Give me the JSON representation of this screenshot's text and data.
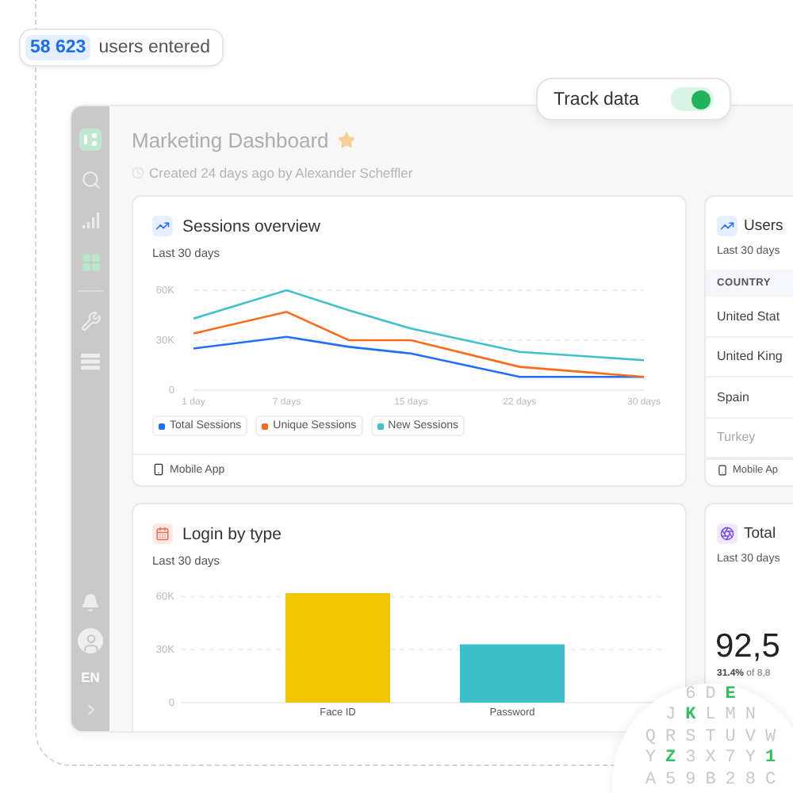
{
  "users_badge": {
    "count": "58 623",
    "label": "users entered"
  },
  "track_toggle": {
    "label": "Track data",
    "on": true
  },
  "sidebar": {
    "nav": [
      {
        "kind": "search",
        "selected": false
      },
      {
        "kind": "bars",
        "selected": false
      },
      {
        "kind": "grid",
        "selected": true
      },
      {
        "kind": "wrench",
        "selected": false
      },
      {
        "kind": "list",
        "selected": false
      }
    ],
    "language": "EN"
  },
  "header": {
    "title": "Marketing Dashboard",
    "starred": true,
    "subtitle": "Created 24 days ago by Alexander Scheffler"
  },
  "sessions_card": {
    "title": "Sessions overview",
    "period": "Last 30 days",
    "chart_data": {
      "type": "line",
      "x": [
        1,
        7,
        11,
        15,
        22,
        30
      ],
      "xlim": [
        1,
        30
      ],
      "xticks": [
        {
          "value": 1,
          "label": "1 day"
        },
        {
          "value": 7,
          "label": "7 days"
        },
        {
          "value": 15,
          "label": "15 days"
        },
        {
          "value": 22,
          "label": "22 days"
        },
        {
          "value": 30,
          "label": "30 days"
        }
      ],
      "yticks": [
        0,
        {
          "value": 30000,
          "label": "30K"
        },
        {
          "value": 60000,
          "label": "60K"
        }
      ],
      "ylim": [
        0,
        60000
      ],
      "series": [
        {
          "name": "Total Sessions",
          "color": "#1f6fff",
          "values": [
            25000,
            32000,
            26000,
            22000,
            8000,
            8000
          ]
        },
        {
          "name": "Unique Sessions",
          "color": "#ff6a1a",
          "values": [
            34000,
            47000,
            30000,
            30000,
            14000,
            8000
          ]
        },
        {
          "name": "New Sessions",
          "color": "#3fc1c9",
          "values": [
            43000,
            60000,
            48000,
            37000,
            23000,
            18000
          ]
        }
      ]
    },
    "footer": "Mobile App"
  },
  "users_card": {
    "title": "Users",
    "period": "Last 30 days",
    "column": "COUNTRY",
    "rows": [
      {
        "country": "United Stat",
        "faded": false
      },
      {
        "country": "United King",
        "faded": false
      },
      {
        "country": "Spain",
        "faded": false
      },
      {
        "country": "Turkey",
        "faded": true
      }
    ],
    "footer": "Mobile Ap"
  },
  "login_card": {
    "title": "Login by type",
    "period": "Last 30 days",
    "chart_data": {
      "type": "bar",
      "yticks": [
        0,
        {
          "value": 30000,
          "label": "30K"
        },
        {
          "value": 60000,
          "label": "60K"
        }
      ],
      "ylim": [
        0,
        62000
      ],
      "stacked": true,
      "series": [
        {
          "name": "Face ID",
          "color": "#f2c600",
          "values": [
            62000,
            null
          ]
        },
        {
          "name": "Password",
          "color": "#3bbfc9",
          "values": [
            null,
            33000
          ]
        }
      ]
    }
  },
  "total_card": {
    "title": "Total",
    "period": "Last 30 days",
    "value": "92,5",
    "note": "**31.4%** of 8,8"
  },
  "letter_grid": [
    [
      {
        "char": "6",
        "highlighted": false
      },
      {
        "char": "D",
        "highlighted": false
      },
      {
        "char": "E",
        "highlighted": true
      }
    ],
    [
      {
        "char": "J",
        "highlighted": false
      },
      {
        "char": "K",
        "highlighted": true
      },
      {
        "char": "L",
        "highlighted": false
      },
      {
        "char": "M",
        "highlighted": false
      },
      {
        "char": "N",
        "highlighted": false
      }
    ],
    [
      {
        "char": "Q",
        "highlighted": false
      },
      {
        "char": "R",
        "highlighted": false
      },
      {
        "char": "S",
        "highlighted": false
      },
      {
        "char": "T",
        "highlighted": false
      },
      {
        "char": "U",
        "highlighted": false
      },
      {
        "char": "V",
        "highlighted": false
      },
      {
        "char": "W",
        "highlighted": false
      }
    ],
    [
      {
        "char": "Y",
        "highlighted": false
      },
      {
        "char": "Z",
        "highlighted": true
      },
      {
        "char": "3",
        "highlighted": false
      },
      {
        "char": "X",
        "highlighted": false
      },
      {
        "char": "7",
        "highlighted": false
      },
      {
        "char": "Y",
        "highlighted": false
      },
      {
        "char": "1",
        "highlighted": true
      }
    ],
    [
      {
        "char": "A",
        "highlighted": false
      },
      {
        "char": "5",
        "highlighted": false
      },
      {
        "char": "9",
        "highlighted": false
      },
      {
        "char": "B",
        "highlighted": false
      },
      {
        "char": "2",
        "highlighted": false
      },
      {
        "char": "8",
        "highlighted": false
      },
      {
        "char": "C",
        "highlighted": false
      }
    ]
  ]
}
